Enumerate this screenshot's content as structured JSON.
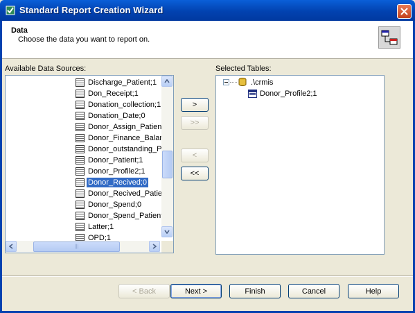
{
  "window": {
    "title": "Standard Report Creation Wizard"
  },
  "header": {
    "title": "Data",
    "subtitle": "Choose the data you want to report on."
  },
  "available": {
    "label": "Available Data Sources:",
    "items": [
      {
        "label": "Discharge_Patient;1",
        "selected": false
      },
      {
        "label": "Don_Receipt;1",
        "selected": false
      },
      {
        "label": "Donation_collection;1",
        "selected": false
      },
      {
        "label": "Donation_Date;0",
        "selected": false
      },
      {
        "label": "Donor_Assign_Patient",
        "selected": false
      },
      {
        "label": "Donor_Finance_Balance",
        "selected": false
      },
      {
        "label": "Donor_outstanding_Pr",
        "selected": false
      },
      {
        "label": "Donor_Patient;1",
        "selected": false
      },
      {
        "label": "Donor_Profile2;1",
        "selected": false
      },
      {
        "label": "Donor_Recived;0",
        "selected": true
      },
      {
        "label": "Donor_Recived_Patien",
        "selected": false
      },
      {
        "label": "Donor_Spend;0",
        "selected": false
      },
      {
        "label": "Donor_Spend_Patient",
        "selected": false
      },
      {
        "label": "Latter;1",
        "selected": false
      },
      {
        "label": "OPD;1",
        "selected": false
      }
    ]
  },
  "selected_tables": {
    "label": "Selected Tables:",
    "root_label": ".\\crmis",
    "children": [
      "Donor_Profile2;1"
    ]
  },
  "transfer_buttons": {
    "add": ">",
    "add_all": ">>",
    "remove": "<",
    "remove_all": "<<"
  },
  "footer": {
    "back": "< Back",
    "next": "Next >",
    "finish": "Finish",
    "cancel": "Cancel",
    "help": "Help"
  },
  "icons": {
    "app": "wizard-app-icon",
    "header": "data-link-icon",
    "close": "close-icon",
    "table": "table-icon",
    "database": "database-icon"
  }
}
